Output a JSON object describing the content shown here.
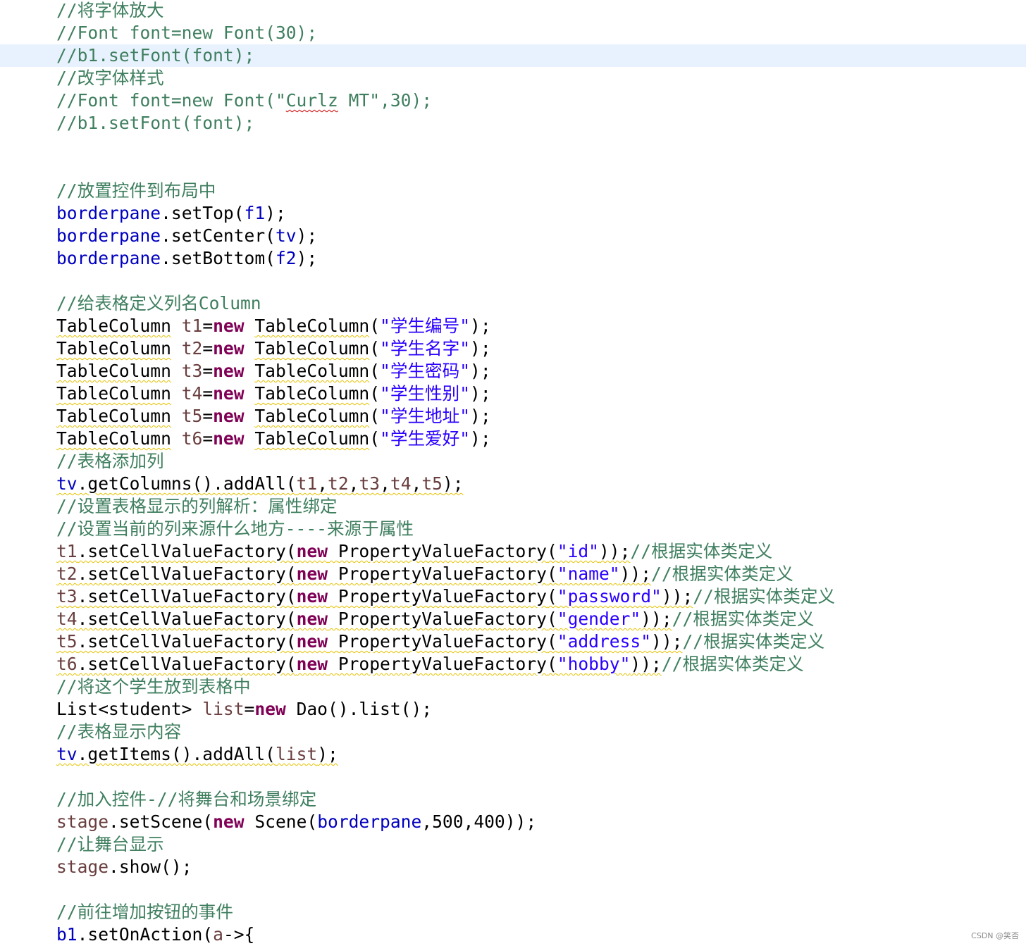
{
  "editor": {
    "lines": [
      {
        "tokens": [
          {
            "t": "//将字体放大",
            "k": "comment"
          }
        ]
      },
      {
        "tokens": [
          {
            "t": "//Font font=new Font(30);",
            "k": "comment"
          }
        ]
      },
      {
        "highlight": true,
        "tokens": [
          {
            "t": "//b1.setFont(font);",
            "k": "comment"
          }
        ]
      },
      {
        "tokens": [
          {
            "t": "//改字体样式",
            "k": "comment"
          }
        ]
      },
      {
        "tokens": [
          {
            "t": "//Font font=new Font(\"",
            "k": "comment"
          },
          {
            "t": "Curlz",
            "k": "comment",
            "d": "spell"
          },
          {
            "t": " MT\",30);",
            "k": "comment"
          }
        ]
      },
      {
        "tokens": [
          {
            "t": "//b1.setFont(font);",
            "k": "comment"
          }
        ]
      },
      {
        "tokens": []
      },
      {
        "tokens": []
      },
      {
        "tokens": [
          {
            "t": "//放置控件到布局中",
            "k": "comment"
          }
        ]
      },
      {
        "tokens": [
          {
            "t": "borderpane",
            "k": "field"
          },
          {
            "t": ".setTop(",
            "k": "plain"
          },
          {
            "t": "f1",
            "k": "field"
          },
          {
            "t": ");",
            "k": "plain"
          }
        ]
      },
      {
        "tokens": [
          {
            "t": "borderpane",
            "k": "field"
          },
          {
            "t": ".setCenter(",
            "k": "plain"
          },
          {
            "t": "tv",
            "k": "field"
          },
          {
            "t": ");",
            "k": "plain"
          }
        ]
      },
      {
        "tokens": [
          {
            "t": "borderpane",
            "k": "field"
          },
          {
            "t": ".setBottom(",
            "k": "plain"
          },
          {
            "t": "f2",
            "k": "field"
          },
          {
            "t": ");",
            "k": "plain"
          }
        ]
      },
      {
        "tokens": []
      },
      {
        "tokens": [
          {
            "t": "//给表格定义列名Column",
            "k": "comment"
          }
        ]
      },
      {
        "tokens": [
          {
            "t": "TableColumn",
            "k": "plain",
            "d": "warn"
          },
          {
            "t": " ",
            "k": "plain"
          },
          {
            "t": "t1",
            "k": "local"
          },
          {
            "t": "=",
            "k": "plain"
          },
          {
            "t": "new",
            "k": "keyword"
          },
          {
            "t": " ",
            "k": "plain"
          },
          {
            "t": "TableColumn",
            "k": "plain",
            "d": "warn"
          },
          {
            "t": "(",
            "k": "plain"
          },
          {
            "t": "\"学生编号\"",
            "k": "string"
          },
          {
            "t": ");",
            "k": "plain"
          }
        ]
      },
      {
        "tokens": [
          {
            "t": "TableColumn",
            "k": "plain",
            "d": "warn"
          },
          {
            "t": " ",
            "k": "plain"
          },
          {
            "t": "t2",
            "k": "local"
          },
          {
            "t": "=",
            "k": "plain"
          },
          {
            "t": "new",
            "k": "keyword"
          },
          {
            "t": " ",
            "k": "plain"
          },
          {
            "t": "TableColumn",
            "k": "plain",
            "d": "warn"
          },
          {
            "t": "(",
            "k": "plain"
          },
          {
            "t": "\"学生名字\"",
            "k": "string"
          },
          {
            "t": ");",
            "k": "plain"
          }
        ]
      },
      {
        "tokens": [
          {
            "t": "TableColumn",
            "k": "plain",
            "d": "warn"
          },
          {
            "t": " ",
            "k": "plain"
          },
          {
            "t": "t3",
            "k": "local"
          },
          {
            "t": "=",
            "k": "plain"
          },
          {
            "t": "new",
            "k": "keyword"
          },
          {
            "t": " ",
            "k": "plain"
          },
          {
            "t": "TableColumn",
            "k": "plain",
            "d": "warn"
          },
          {
            "t": "(",
            "k": "plain"
          },
          {
            "t": "\"学生密码\"",
            "k": "string"
          },
          {
            "t": ");",
            "k": "plain"
          }
        ]
      },
      {
        "tokens": [
          {
            "t": "TableColumn",
            "k": "plain",
            "d": "warn"
          },
          {
            "t": " ",
            "k": "plain"
          },
          {
            "t": "t4",
            "k": "local"
          },
          {
            "t": "=",
            "k": "plain"
          },
          {
            "t": "new",
            "k": "keyword"
          },
          {
            "t": " ",
            "k": "plain"
          },
          {
            "t": "TableColumn",
            "k": "plain",
            "d": "warn"
          },
          {
            "t": "(",
            "k": "plain"
          },
          {
            "t": "\"学生性别\"",
            "k": "string"
          },
          {
            "t": ");",
            "k": "plain"
          }
        ]
      },
      {
        "tokens": [
          {
            "t": "TableColumn",
            "k": "plain",
            "d": "warn"
          },
          {
            "t": " ",
            "k": "plain"
          },
          {
            "t": "t5",
            "k": "local"
          },
          {
            "t": "=",
            "k": "plain"
          },
          {
            "t": "new",
            "k": "keyword"
          },
          {
            "t": " ",
            "k": "plain"
          },
          {
            "t": "TableColumn",
            "k": "plain",
            "d": "warn"
          },
          {
            "t": "(",
            "k": "plain"
          },
          {
            "t": "\"学生地址\"",
            "k": "string"
          },
          {
            "t": ");",
            "k": "plain"
          }
        ]
      },
      {
        "tokens": [
          {
            "t": "TableColumn",
            "k": "plain",
            "d": "warn"
          },
          {
            "t": " ",
            "k": "plain"
          },
          {
            "t": "t6",
            "k": "local"
          },
          {
            "t": "=",
            "k": "plain"
          },
          {
            "t": "new",
            "k": "keyword"
          },
          {
            "t": " ",
            "k": "plain"
          },
          {
            "t": "TableColumn",
            "k": "plain",
            "d": "warn"
          },
          {
            "t": "(",
            "k": "plain"
          },
          {
            "t": "\"学生爱好\"",
            "k": "string"
          },
          {
            "t": ");",
            "k": "plain"
          }
        ]
      },
      {
        "tokens": [
          {
            "t": "//表格添加列",
            "k": "comment"
          }
        ]
      },
      {
        "tokens": [
          {
            "t": "tv",
            "k": "field",
            "d": "warn"
          },
          {
            "t": ".getColumns().addAll(",
            "k": "plain",
            "d": "warn"
          },
          {
            "t": "t1",
            "k": "local",
            "d": "warn"
          },
          {
            "t": ",",
            "k": "plain",
            "d": "warn"
          },
          {
            "t": "t2",
            "k": "local",
            "d": "warn"
          },
          {
            "t": ",",
            "k": "plain",
            "d": "warn"
          },
          {
            "t": "t3",
            "k": "local",
            "d": "warn"
          },
          {
            "t": ",",
            "k": "plain",
            "d": "warn"
          },
          {
            "t": "t4",
            "k": "local",
            "d": "warn"
          },
          {
            "t": ",",
            "k": "plain",
            "d": "warn"
          },
          {
            "t": "t5",
            "k": "local",
            "d": "warn"
          },
          {
            "t": ");",
            "k": "plain",
            "d": "warn"
          }
        ]
      },
      {
        "tokens": [
          {
            "t": "//设置表格显示的列解析：属性绑定",
            "k": "comment"
          }
        ]
      },
      {
        "tokens": [
          {
            "t": "//设置当前的列来源什么地方----来源于属性",
            "k": "comment"
          }
        ]
      },
      {
        "tokens": [
          {
            "t": "t1",
            "k": "local",
            "d": "warn"
          },
          {
            "t": ".setCellValueFactory(",
            "k": "plain",
            "d": "warn"
          },
          {
            "t": "new",
            "k": "keyword",
            "d": "warn"
          },
          {
            "t": " ",
            "k": "plain",
            "d": "warn"
          },
          {
            "t": "PropertyValueFactory",
            "k": "plain",
            "d": "warn"
          },
          {
            "t": "(",
            "k": "plain",
            "d": "warn"
          },
          {
            "t": "\"id\"",
            "k": "string",
            "d": "warn"
          },
          {
            "t": "));",
            "k": "plain",
            "d": "warn"
          },
          {
            "t": "//根据实体类定义",
            "k": "comment"
          }
        ]
      },
      {
        "tokens": [
          {
            "t": "t2",
            "k": "local",
            "d": "warn"
          },
          {
            "t": ".setCellValueFactory(",
            "k": "plain",
            "d": "warn"
          },
          {
            "t": "new",
            "k": "keyword",
            "d": "warn"
          },
          {
            "t": " ",
            "k": "plain",
            "d": "warn"
          },
          {
            "t": "PropertyValueFactory",
            "k": "plain",
            "d": "warn"
          },
          {
            "t": "(",
            "k": "plain",
            "d": "warn"
          },
          {
            "t": "\"name\"",
            "k": "string",
            "d": "warn"
          },
          {
            "t": "));",
            "k": "plain",
            "d": "warn"
          },
          {
            "t": "//根据实体类定义",
            "k": "comment"
          }
        ]
      },
      {
        "tokens": [
          {
            "t": "t3",
            "k": "local",
            "d": "warn"
          },
          {
            "t": ".setCellValueFactory(",
            "k": "plain",
            "d": "warn"
          },
          {
            "t": "new",
            "k": "keyword",
            "d": "warn"
          },
          {
            "t": " ",
            "k": "plain",
            "d": "warn"
          },
          {
            "t": "PropertyValueFactory",
            "k": "plain",
            "d": "warn"
          },
          {
            "t": "(",
            "k": "plain",
            "d": "warn"
          },
          {
            "t": "\"password\"",
            "k": "string",
            "d": "warn"
          },
          {
            "t": "));",
            "k": "plain",
            "d": "warn"
          },
          {
            "t": "//根据实体类定义",
            "k": "comment"
          }
        ]
      },
      {
        "tokens": [
          {
            "t": "t4",
            "k": "local",
            "d": "warn"
          },
          {
            "t": ".setCellValueFactory(",
            "k": "plain",
            "d": "warn"
          },
          {
            "t": "new",
            "k": "keyword",
            "d": "warn"
          },
          {
            "t": " ",
            "k": "plain",
            "d": "warn"
          },
          {
            "t": "PropertyValueFactory",
            "k": "plain",
            "d": "warn"
          },
          {
            "t": "(",
            "k": "plain",
            "d": "warn"
          },
          {
            "t": "\"gender\"",
            "k": "string",
            "d": "warn"
          },
          {
            "t": "));",
            "k": "plain",
            "d": "warn"
          },
          {
            "t": "//根据实体类定义",
            "k": "comment"
          }
        ]
      },
      {
        "tokens": [
          {
            "t": "t5",
            "k": "local",
            "d": "warn"
          },
          {
            "t": ".setCellValueFactory(",
            "k": "plain",
            "d": "warn"
          },
          {
            "t": "new",
            "k": "keyword",
            "d": "warn"
          },
          {
            "t": " ",
            "k": "plain",
            "d": "warn"
          },
          {
            "t": "PropertyValueFactory",
            "k": "plain",
            "d": "warn"
          },
          {
            "t": "(",
            "k": "plain",
            "d": "warn"
          },
          {
            "t": "\"address\"",
            "k": "string",
            "d": "warn"
          },
          {
            "t": "));",
            "k": "plain",
            "d": "warn"
          },
          {
            "t": "//根据实体类定义",
            "k": "comment"
          }
        ]
      },
      {
        "tokens": [
          {
            "t": "t6",
            "k": "local",
            "d": "warn"
          },
          {
            "t": ".setCellValueFactory(",
            "k": "plain",
            "d": "warn"
          },
          {
            "t": "new",
            "k": "keyword",
            "d": "warn"
          },
          {
            "t": " ",
            "k": "plain",
            "d": "warn"
          },
          {
            "t": "PropertyValueFactory",
            "k": "plain",
            "d": "warn"
          },
          {
            "t": "(",
            "k": "plain",
            "d": "warn"
          },
          {
            "t": "\"hobby\"",
            "k": "string",
            "d": "warn"
          },
          {
            "t": "));",
            "k": "plain",
            "d": "warn"
          },
          {
            "t": "//根据实体类定义",
            "k": "comment"
          }
        ]
      },
      {
        "tokens": [
          {
            "t": "//将这个学生放到表格中",
            "k": "comment"
          }
        ]
      },
      {
        "tokens": [
          {
            "t": "List<student> ",
            "k": "plain"
          },
          {
            "t": "list",
            "k": "local"
          },
          {
            "t": "=",
            "k": "plain"
          },
          {
            "t": "new",
            "k": "keyword"
          },
          {
            "t": " Dao().list();",
            "k": "plain"
          }
        ]
      },
      {
        "tokens": [
          {
            "t": "//表格显示内容",
            "k": "comment"
          }
        ]
      },
      {
        "tokens": [
          {
            "t": "tv",
            "k": "field",
            "d": "warn"
          },
          {
            "t": ".getItems().addAll(",
            "k": "plain",
            "d": "warn"
          },
          {
            "t": "list",
            "k": "local",
            "d": "warn"
          },
          {
            "t": ");",
            "k": "plain",
            "d": "warn"
          }
        ]
      },
      {
        "tokens": []
      },
      {
        "tokens": [
          {
            "t": "//加入控件-//将舞台和场景绑定",
            "k": "comment"
          }
        ]
      },
      {
        "tokens": [
          {
            "t": "stage",
            "k": "local"
          },
          {
            "t": ".setScene(",
            "k": "plain"
          },
          {
            "t": "new",
            "k": "keyword"
          },
          {
            "t": " Scene(",
            "k": "plain"
          },
          {
            "t": "borderpane",
            "k": "field"
          },
          {
            "t": ",500,400));",
            "k": "plain"
          }
        ]
      },
      {
        "tokens": [
          {
            "t": "//让舞台显示",
            "k": "comment"
          }
        ]
      },
      {
        "tokens": [
          {
            "t": "stage",
            "k": "local"
          },
          {
            "t": ".show();",
            "k": "plain"
          }
        ]
      },
      {
        "tokens": []
      },
      {
        "tokens": [
          {
            "t": "//前往增加按钮的事件",
            "k": "comment"
          }
        ]
      },
      {
        "tokens": [
          {
            "t": "b1",
            "k": "field"
          },
          {
            "t": ".setOnAction(",
            "k": "plain"
          },
          {
            "t": "a",
            "k": "local"
          },
          {
            "t": "->{",
            "k": "plain"
          }
        ]
      }
    ]
  },
  "watermark": "CSDN @笑否",
  "colors": {
    "background": "#ffffff",
    "current_line": "#e8f2fe",
    "comment": "#3f7f5f",
    "field": "#0000c0",
    "keyword": "#7f0055",
    "string": "#2a00ff",
    "local": "#6a3e3e",
    "plain": "#000000",
    "warning_underline": "#e6c200",
    "spell_underline": "#d00000"
  }
}
